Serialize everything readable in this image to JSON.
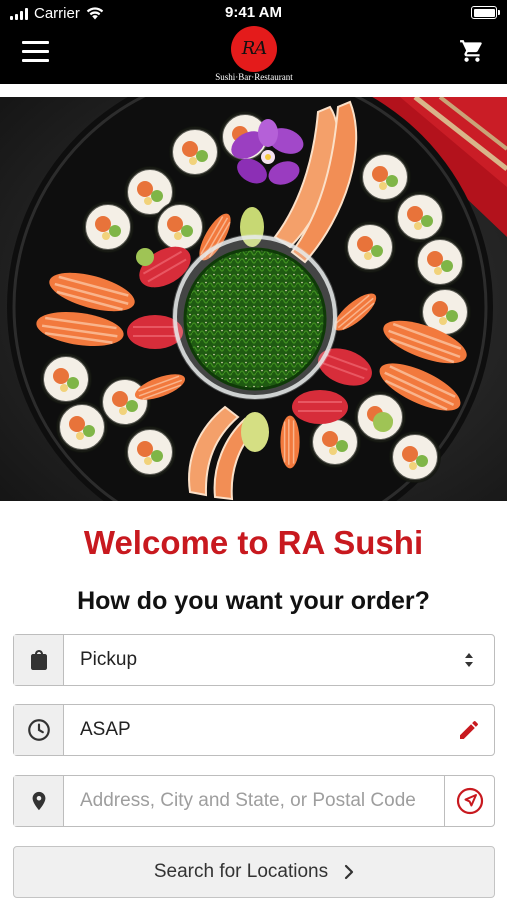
{
  "status_bar": {
    "carrier": "Carrier",
    "time": "9:41 AM"
  },
  "header": {
    "logo_text": "RA",
    "logo_tagline": "Sushi·Bar·Restaurant",
    "icons": [
      "menu-icon",
      "cart-icon"
    ]
  },
  "hero": {
    "icon": "sushi-platter-photo"
  },
  "main": {
    "welcome": "Welcome to RA Sushi",
    "question": "How do you want your order?"
  },
  "order_type": {
    "icon": "shopping-bag-icon",
    "value": "Pickup"
  },
  "order_time": {
    "icon": "clock-icon",
    "value": "ASAP",
    "edit_icon": "pencil-icon"
  },
  "address": {
    "icon": "location-pin-icon",
    "placeholder": "Address, City and State, or Postal Code",
    "value": "",
    "locate_icon": "navigation-arrow-icon"
  },
  "search_button": {
    "label": "Search for Locations",
    "icon": "chevron-right-icon"
  },
  "colors": {
    "brand_red": "#c8191f",
    "logo_red": "#e41b1b",
    "header_bg": "#000000"
  }
}
